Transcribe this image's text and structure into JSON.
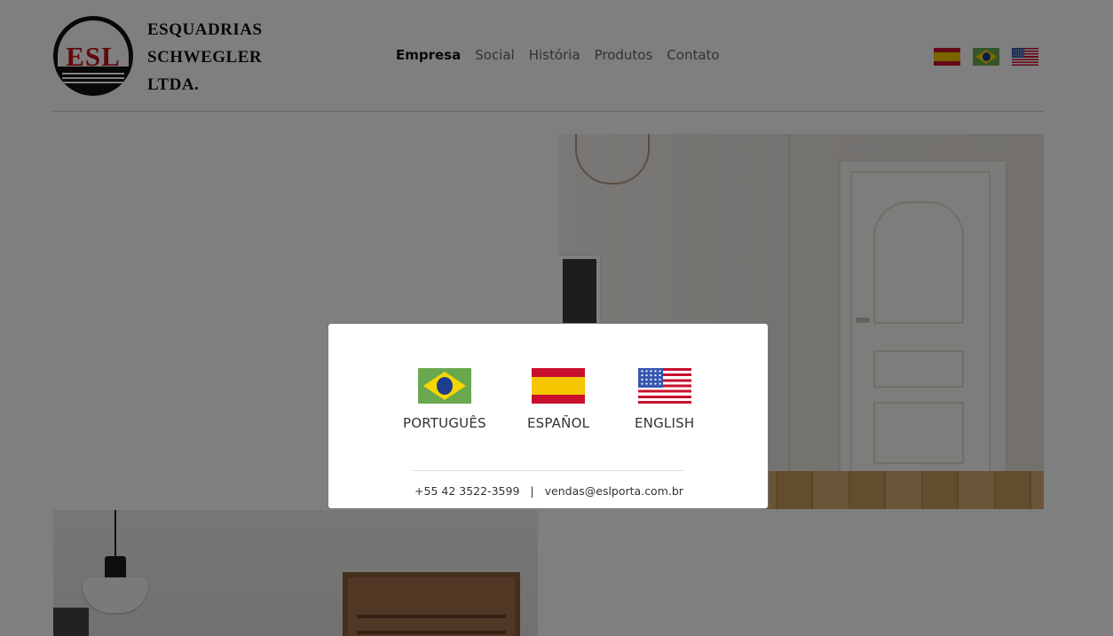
{
  "header": {
    "logo_text": "ESL",
    "brand_lines": [
      "ESQUADRIAS",
      "SCHWEGLER",
      "LTDA."
    ],
    "nav": [
      {
        "label": "Empresa",
        "active": true
      },
      {
        "label": "Social",
        "active": false
      },
      {
        "label": "História",
        "active": false
      },
      {
        "label": "Produtos",
        "active": false
      },
      {
        "label": "Contato",
        "active": false
      }
    ],
    "flags": [
      "spain-flag-icon",
      "brazil-flag-icon",
      "usa-flag-icon"
    ]
  },
  "modal": {
    "languages": [
      {
        "label": "PORTUGUÊS",
        "icon": "brazil-flag-icon"
      },
      {
        "label": "ESPAÑOL",
        "icon": "spain-flag-icon"
      },
      {
        "label": "ENGLISH",
        "icon": "usa-flag-icon"
      }
    ],
    "phone": "+55 42 3522-3599",
    "separator": "|",
    "email": "vendas@eslporta.com.br"
  },
  "colors": {
    "overlay": "rgba(0,0,0,0.5)",
    "logo_red": "#c1121a",
    "nav_active": "#111111",
    "nav_inactive": "#666666"
  }
}
